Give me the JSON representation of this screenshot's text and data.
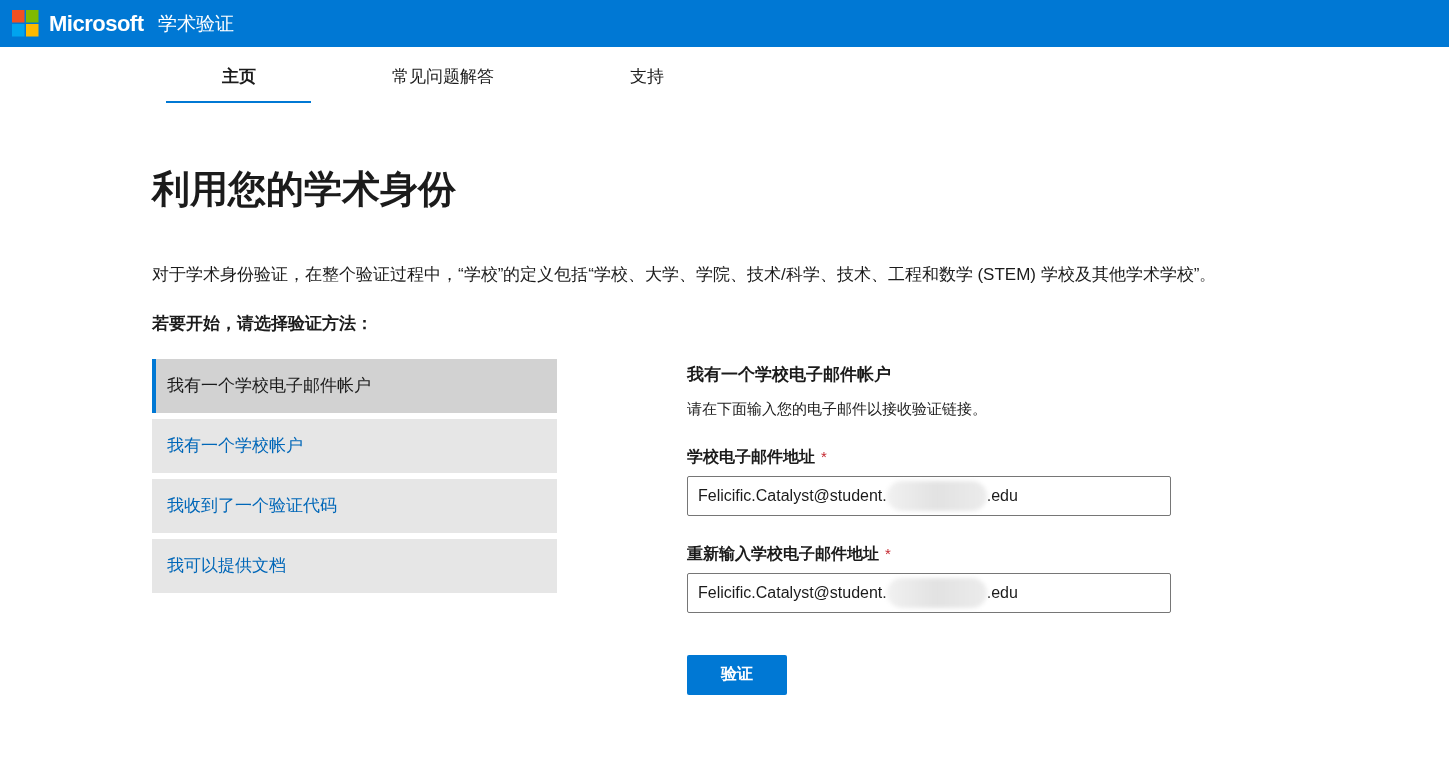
{
  "header": {
    "brand": "Microsoft",
    "title": "学术验证"
  },
  "tabs": [
    {
      "label": "主页",
      "selected": true
    },
    {
      "label": "常见问题解答",
      "selected": false
    },
    {
      "label": "支持",
      "selected": false
    }
  ],
  "heading": "利用您的学术身份",
  "intro": "对于学术身份验证，在整个验证过程中，“学校”的定义包括“学校、大学、学院、技术/科学、技术、工程和数学 (STEM) 学校及其他学术学校”。",
  "prompt": "若要开始，请选择验证方法：",
  "methods": [
    {
      "label": "我有一个学校电子邮件帐户",
      "selected": true
    },
    {
      "label": "我有一个学校帐户",
      "selected": false
    },
    {
      "label": "我收到了一个验证代码",
      "selected": false
    },
    {
      "label": "我可以提供文档",
      "selected": false
    }
  ],
  "panel": {
    "title": "我有一个学校电子邮件帐户",
    "description": "请在下面输入您的电子邮件以接收验证链接。",
    "fields": [
      {
        "label": "学校电子邮件地址",
        "required_mark": "*",
        "value_start": "Felicific.Catalyst@student.",
        "value_end": ".edu",
        "redacted": true
      },
      {
        "label": "重新输入学校电子邮件地址",
        "required_mark": "*",
        "value_start": "Felicific.Catalyst@student.",
        "value_end": ".edu",
        "redacted": true
      }
    ],
    "button": "验证"
  }
}
